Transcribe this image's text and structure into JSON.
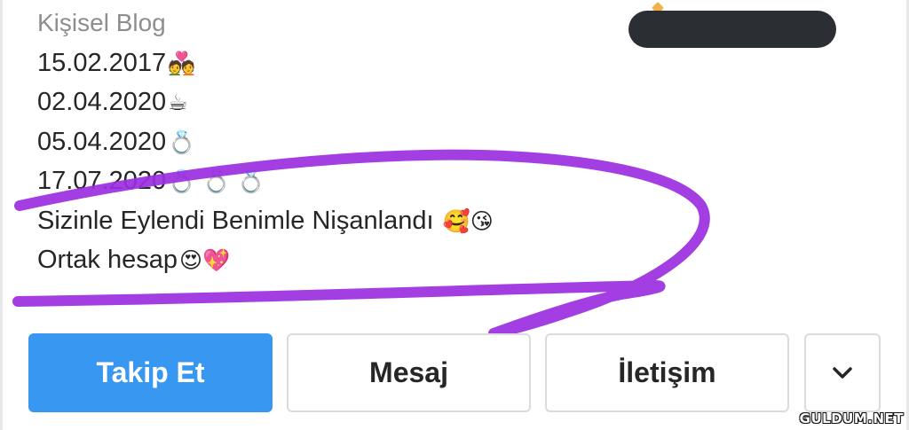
{
  "profile": {
    "category": "Kişisel Blog",
    "bio_lines": [
      {
        "text": "15.02.2017",
        "emoji": "💑"
      },
      {
        "text": "02.04.2020",
        "emoji": "☕"
      },
      {
        "text": "05.04.2020",
        "emoji": "💍"
      },
      {
        "text": "17.07.2020",
        "emoji": "💍 💍 💍"
      },
      {
        "text": "Sizinle Eylendi Benimle Nişanlandı ",
        "emoji": "🥰😘"
      },
      {
        "text": "Ortak hesap",
        "emoji": "😍💖"
      }
    ]
  },
  "actions": {
    "follow_label": "Takip Et",
    "message_label": "Mesaj",
    "contact_label": "İletişim",
    "more_icon": "chevron-down-icon"
  },
  "watermark": "GULDUM.NET",
  "colors": {
    "follow_button": "#3897f0",
    "scribble": "#9a2ee0",
    "redaction": "#2b2f33"
  }
}
